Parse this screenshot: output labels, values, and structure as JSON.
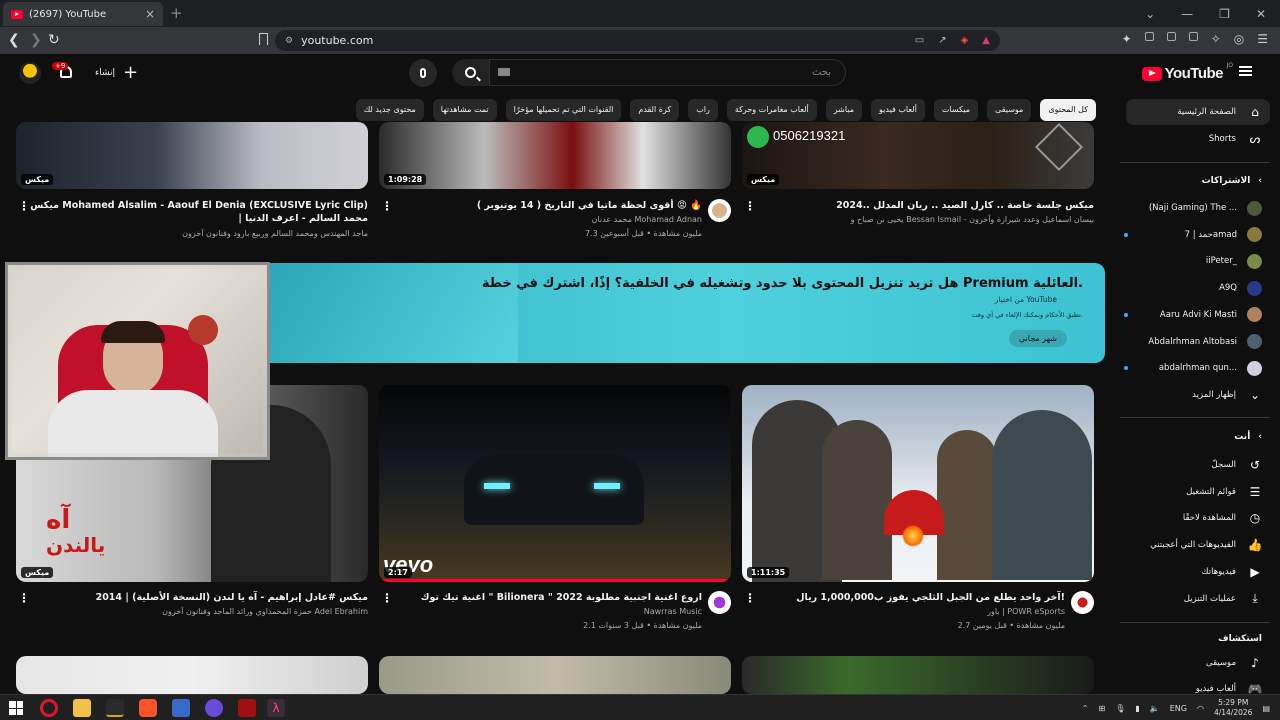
{
  "browser": {
    "tab_title": "(2697) YouTube",
    "url": "youtube.com",
    "new_tab": "+"
  },
  "header": {
    "logo_text": "YouTube",
    "country_code": "JO",
    "search_placeholder": "بحث",
    "create_label": "إنشاء",
    "notifications_badge": "+9"
  },
  "chips": [
    "كل المحتوى",
    "موسيقى",
    "ميكسات",
    "ألعاب فيديو",
    "مباشر",
    "ألعاب مغامرات وحركة",
    "راب",
    "كرة القدم",
    "القنوات التي تم تحميلها مؤخرًا",
    "تمت مشاهدتها",
    "محتوى جديد لك"
  ],
  "sidebar": {
    "home": "الصفحة الرئيسية",
    "shorts": "Shorts",
    "subscriptions_header": "الاشتراكات",
    "subscriptions": [
      {
        "name": "(Naji Gaming) The ...",
        "new": false,
        "color": "#4a5a3a"
      },
      {
        "name": "حمد | 7amad",
        "new": true,
        "color": "#8a7a3a"
      },
      {
        "name": "iiPeter_",
        "new": false,
        "color": "#7a8a4a"
      },
      {
        "name": "A9Q",
        "new": false,
        "color": "#2a3a8a"
      },
      {
        "name": "Aaru Advi Ki Masti",
        "new": true,
        "color": "#b08060"
      },
      {
        "name": "Abdalrhman Altobasi",
        "new": false,
        "color": "#506070"
      },
      {
        "name": "abdalrhman qun...",
        "new": true,
        "color": "#d0d0e0"
      }
    ],
    "show_more": "إظهار المزيد",
    "you_header": "أنت",
    "you_items": [
      "السجلّ",
      "قوائم التشغيل",
      "المشاهدة لاحقًا",
      "الفيديوهات التي أعجبتني",
      "فيديوهاتك",
      "عمليات التنزيل"
    ],
    "explore_header": "استكشاف",
    "explore_items": [
      "موسيقى",
      "ألعاب فيديو"
    ]
  },
  "row1": [
    {
      "title": "ميكس جلسة خاصة .. كارل الصيد .. ريان المدلل ..2024",
      "channel": "يحيى بن صباح و Bessan Ismail - بيسان اسماعيل وعدد شيرازة وآخرون",
      "meta": "",
      "badge": "ميكس",
      "dur": ""
    },
    {
      "title": "أقوى لحظة ماتيا في التاريخ ( 14 يوتيوبر ) 😡 🔥",
      "channel": "محمد عدنان Mohamad Adnan",
      "meta": "7.3 مليون مشاهدة • قبل أسبوعين",
      "badge": "",
      "dur": "1:09:28"
    },
    {
      "title": "ميكس Mohamed Alsalim - Aaouf El Denia (EXCLUSIVE Lyric Clip) | محمد السالم - اعرف الدنيا",
      "channel": "ماجد المهندس ومحمد السالم وربيع بارود وفنانون آخرون",
      "meta": "",
      "badge": "ميكس",
      "dur": ""
    }
  ],
  "premium": {
    "title": "هل تريد تنزيل المحتوى بلا حدود وتشغيله في الخلفية؟ إذًا، اشترك في خطة Premium العائلية.",
    "from": "من اختيار YouTube",
    "fine": "تطبق الأحكام ويمكنك الإلغاء في أي وقت.",
    "button": "شهر مجاني"
  },
  "row2": [
    {
      "title": "آخر واحد يطلع من الجبل الثلجي يفوز ب1,000,000 ريال!",
      "channel": "باور | POWR eSports",
      "meta": "2.7 مليون مشاهدة • قبل يومين",
      "dur": "1:11:35"
    },
    {
      "title": "اغنية تيك توك \" Bilionera \" اروع اغنية اجنبية مطلوبة 2022",
      "channel": "Nawrras Music",
      "meta": "2.1 مليون مشاهدة • قبل 3 سنوات",
      "dur": "2:17"
    },
    {
      "title": "ميكس #عادل إبراهيم - آه يا لندن (النسخة الأصلية) | 2014",
      "channel": "حمزة المحمداوي ورائد الماجد وفنانون آخرون Adel Ebrahim",
      "meta": "",
      "dur": "ميكس"
    }
  ],
  "taskbar": {
    "lang": "ENG",
    "time": "5:29 PM",
    "date": "4/14/2026"
  }
}
